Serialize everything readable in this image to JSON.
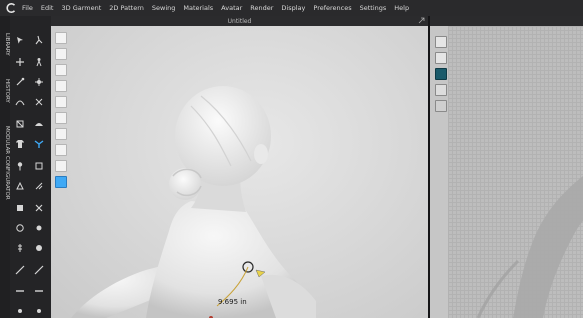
{
  "app": {
    "menu": [
      "File",
      "Edit",
      "3D Garment",
      "2D Pattern",
      "Sewing",
      "Materials",
      "Avatar",
      "Render",
      "Display",
      "Preferences",
      "Settings",
      "Help"
    ]
  },
  "sidebar": {
    "tabs": [
      "LIBRARY",
      "HISTORY",
      "MODULAR CONFIGURATOR"
    ]
  },
  "window": {
    "title": "Untitled"
  },
  "viewport": {
    "measurement": "9.695 in"
  },
  "colors": {
    "menubar": "#2a2a2c",
    "viewport_bg": "#dcdcdc",
    "accent_blue": "#3fa9f5",
    "pattern_bg": "#bdbdbd"
  },
  "icons": {
    "logo": "clo-logo-icon",
    "expand": "expand-icon"
  }
}
